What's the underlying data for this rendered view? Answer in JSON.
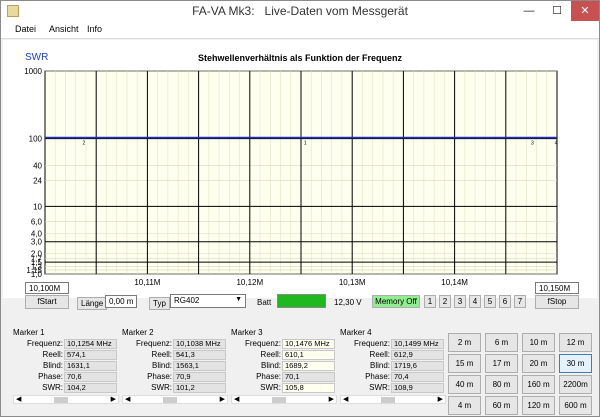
{
  "window": {
    "title": "FA-VA Mk3:   Live-Daten vom Messgerät",
    "min": "—",
    "max": "☐",
    "close": "✕"
  },
  "menu": [
    "Datei",
    "Ansicht",
    "Info"
  ],
  "chart": {
    "swr_label": "SWR"
  },
  "chart_data": {
    "type": "line",
    "title": "Stehwellenverhältnis als Funktion der Frequenz",
    "ylabel": "SWR",
    "y_scale": "log",
    "y_ticks": [
      "1000",
      "100",
      "40",
      "24",
      "10",
      "6,0",
      "4,0",
      "3,0",
      "2,0",
      "1,7",
      "1,5",
      "1,3",
      "1,15",
      "1,0"
    ],
    "x_ticks": [
      "10,11M",
      "10,12M",
      "10,13M",
      "10,14M"
    ],
    "x_range_mhz": [
      10.1,
      10.15
    ],
    "grid": true,
    "series": [
      {
        "color": "#2030c0",
        "x": [
          10.1,
          10.11,
          10.12,
          10.13,
          10.14,
          10.15
        ],
        "y": [
          104,
          104,
          104,
          104,
          104,
          104
        ]
      }
    ],
    "marker_labels": [
      "1",
      "2",
      "3",
      "4"
    ]
  },
  "controls": {
    "fstart_value": "10,100M",
    "fstop_value": "10,150M",
    "fstart_btn": "fStart",
    "fstop_btn": "fStop",
    "laenge_label": "Länge",
    "laenge_value": "0,00 m",
    "typ_label": "Typ",
    "typ_value": "RG402",
    "batt_label": "Batt",
    "batt_voltage": "12,30 V",
    "batt_color": "#1fb81f",
    "memory_btn": "Memory Off",
    "memory_color": "#90ee90",
    "memory_slots": [
      "1",
      "2",
      "3",
      "4",
      "5",
      "6",
      "7"
    ]
  },
  "markers": [
    {
      "title": "Marker 1",
      "rows": [
        [
          "Frequenz:",
          "10,1254 MHz"
        ],
        [
          "Reell:",
          "574,1"
        ],
        [
          "Blind:",
          "1631,1"
        ],
        [
          "Phase:",
          "70,6"
        ],
        [
          "SWR:",
          "104,2"
        ]
      ]
    },
    {
      "title": "Marker 2",
      "rows": [
        [
          "Frequenz:",
          "10,1038 MHz"
        ],
        [
          "Reell:",
          "541,3"
        ],
        [
          "Blind:",
          "1563,1"
        ],
        [
          "Phase:",
          "70,9"
        ],
        [
          "SWR:",
          "101,2"
        ]
      ]
    },
    {
      "title": "Marker 3",
      "rows": [
        [
          "Frequenz:",
          "10,1476 MHz"
        ],
        [
          "Reell:",
          "610,1"
        ],
        [
          "Blind:",
          "1689,2"
        ],
        [
          "Phase:",
          "70,1"
        ],
        [
          "SWR:",
          "105,8"
        ]
      ]
    },
    {
      "title": "Marker 4",
      "rows": [
        [
          "Frequenz:",
          "10,1499 MHz"
        ],
        [
          "Reell:",
          "612,9"
        ],
        [
          "Blind:",
          "1719,6"
        ],
        [
          "Phase:",
          "70,4"
        ],
        [
          "SWR:",
          "108,9"
        ]
      ]
    }
  ],
  "bands": [
    "2 m",
    "6 m",
    "10 m",
    "12 m",
    "15 m",
    "17 m",
    "20 m",
    "30 m",
    "40 m",
    "80 m",
    "160 m",
    "2200m",
    "4 m",
    "60 m",
    "120 m",
    "600 m"
  ],
  "selected_band": "30 m"
}
